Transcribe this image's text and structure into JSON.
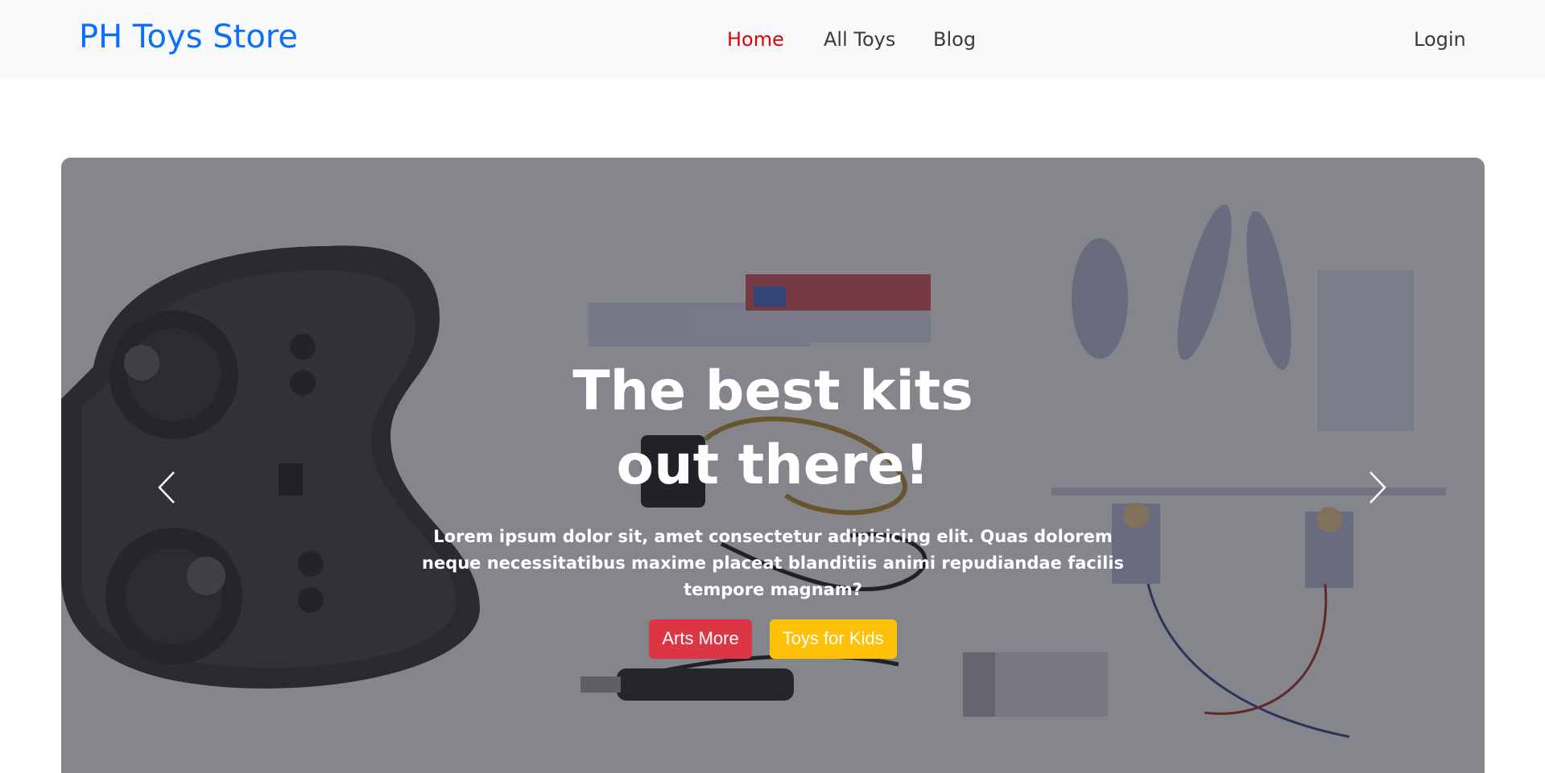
{
  "navbar": {
    "brand": "PH Toys Store",
    "links": [
      {
        "label": "Home",
        "active": true
      },
      {
        "label": "All Toys",
        "active": false
      },
      {
        "label": "Blog",
        "active": false
      }
    ],
    "login_label": "Login"
  },
  "hero": {
    "headline": "The best kits out there!",
    "subtext": "Lorem ipsum dolor sit, amet consectetur adipisicing elit. Quas dolorem neque necessitatibus maxime placeat blanditiis animi repudiandae facilis tempore magnam?",
    "buttons": {
      "primary_label": "Arts More",
      "secondary_label": "Toys for Kids"
    },
    "prev_icon": "chevron-left-icon",
    "next_icon": "chevron-right-icon"
  },
  "colors": {
    "brand": "#0d6efd",
    "nav_active": "#e30000",
    "navbar_bg": "#f8f9fa",
    "button_red": "#dc3545",
    "button_yellow": "#ffc107"
  }
}
